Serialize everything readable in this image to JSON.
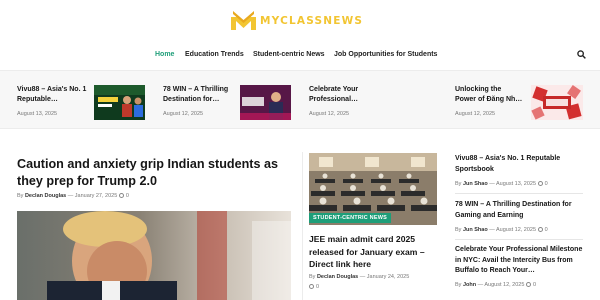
{
  "brand": {
    "name": "MYCLASSNEWS",
    "accent": "#f2c532"
  },
  "nav": {
    "items": [
      "Home",
      "Education Trends",
      "Student-centric News",
      "Job Opportunities for Students"
    ],
    "active": "Home",
    "active_color": "#1e9e79",
    "search_icon": "search-icon"
  },
  "ticker": [
    {
      "title1": "Vivu88 – Asia's No. 1",
      "title2": "Reputable…",
      "date": "August 13, 2025"
    },
    {
      "title1": "78 WIN – A Thrilling",
      "title2": "Destination for…",
      "date": "August 12, 2025"
    },
    {
      "title1": "Celebrate Your",
      "title2": "Professional…",
      "date": "August 12, 2025"
    },
    {
      "title1": "Unlocking the",
      "title2": "Power of Đăng Nh…",
      "date": "August 12, 2025"
    }
  ],
  "main": {
    "title": "Caution and anxiety grip Indian students as they prep for Trump 2.0",
    "by": "By",
    "author": "Declan Douglas",
    "sep": "—",
    "date": "January 27, 2025",
    "comments": "0"
  },
  "middle": {
    "badge": "STUDENT-CENTRIC NEWS",
    "title": "JEE main admit card 2025 released for January exam – Direct link here",
    "by": "By",
    "author": "Declan Douglas",
    "sep": "—",
    "date": "January 24, 2025",
    "comments": "0"
  },
  "side": [
    {
      "title": "Vivu88 – Asia's No. 1 Reputable Sportsbook",
      "by": "By",
      "author": "Jun Shao",
      "sep": "—",
      "date": "August 13, 2025",
      "comments": "0"
    },
    {
      "title": "78 WIN – A Thrilling Destination for Gaming and Earning",
      "by": "By",
      "author": "Jun Shao",
      "sep": "—",
      "date": "August 12, 2025",
      "comments": "0"
    },
    {
      "title": "Celebrate Your Professional Milestone in NYC: Avail the Intercity Bus from Buffalo to Reach Your…",
      "by": "By",
      "author": "John",
      "sep": "—",
      "date": "August 12, 2025",
      "comments": "0"
    }
  ]
}
